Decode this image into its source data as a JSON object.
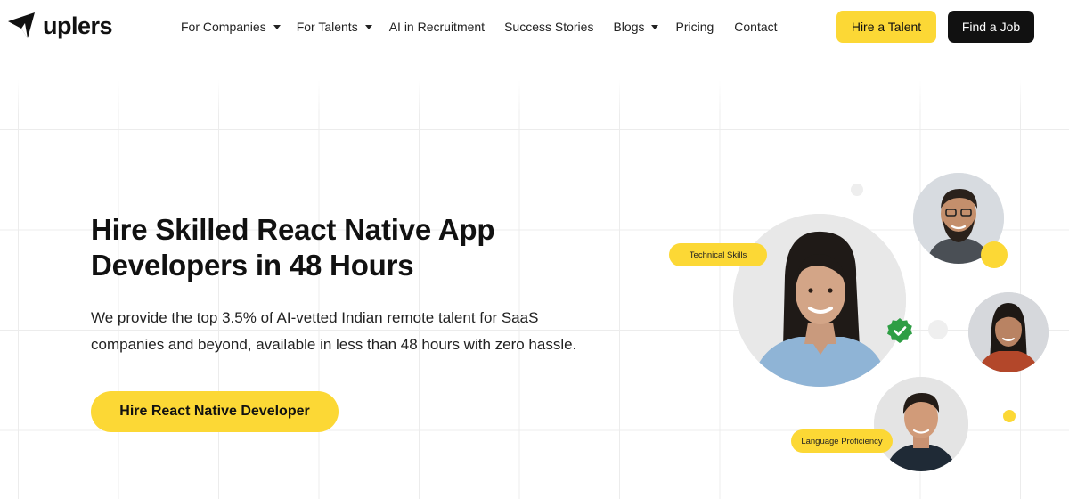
{
  "brand": {
    "name": "uplers"
  },
  "nav": {
    "items": [
      {
        "label": "For Companies",
        "has_dropdown": true
      },
      {
        "label": "For Talents",
        "has_dropdown": true
      },
      {
        "label": "AI in Recruitment",
        "has_dropdown": false
      },
      {
        "label": "Success Stories",
        "has_dropdown": false
      },
      {
        "label": "Blogs",
        "has_dropdown": true
      },
      {
        "label": "Pricing",
        "has_dropdown": false
      },
      {
        "label": "Contact",
        "has_dropdown": false
      }
    ],
    "hire_talent_label": "Hire a Talent",
    "find_job_label": "Find a Job"
  },
  "hero": {
    "title_line1": "Hire Skilled React Native App",
    "title_line2": "Developers in 48 Hours",
    "subtitle_line1": "We provide the top 3.5% of AI-vetted Indian remote talent for SaaS",
    "subtitle_line2": "companies and beyond, available in less than 48 hours with zero hassle.",
    "cta_label": "Hire React Native Developer"
  },
  "tags": {
    "technical": "Technical Skills",
    "language": "Language Proficiency"
  },
  "icons": {
    "logo": "uplers-logo-icon",
    "dropdown": "chevron-down-icon",
    "verified": "check-badge-icon"
  },
  "colors": {
    "accent_yellow": "#fcd835",
    "dark": "#111111",
    "verified_green": "#2e9e44"
  }
}
